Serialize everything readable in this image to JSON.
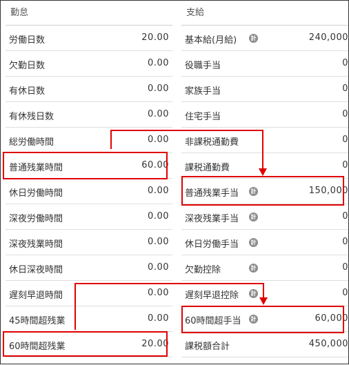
{
  "attendance": {
    "title": "勤怠",
    "rows": [
      {
        "label": "労働日数",
        "value": "20.00"
      },
      {
        "label": "欠勤日数",
        "value": "0.00"
      },
      {
        "label": "有休日数",
        "value": "0.00"
      },
      {
        "label": "有休残日数",
        "value": "0.00"
      },
      {
        "label": "総労働時間",
        "value": "0.00"
      },
      {
        "label": "普通残業時間",
        "value": "60.00"
      },
      {
        "label": "休日労働時間",
        "value": "0.00"
      },
      {
        "label": "深夜労働時間",
        "value": "0.00"
      },
      {
        "label": "深夜残業時間",
        "value": "0.00"
      },
      {
        "label": "休日深夜時間",
        "value": "0.00"
      },
      {
        "label": "遅刻早退時間",
        "value": "0.00"
      },
      {
        "label": "45時間超残業",
        "value": "0.00"
      },
      {
        "label": "60時間超残業",
        "value": "20.00"
      }
    ]
  },
  "payment": {
    "title": "支給",
    "calc_icon_glyph": "計",
    "rows": [
      {
        "label": "基本給(月給)",
        "value": "240,000",
        "calc_icon": true
      },
      {
        "label": "役職手当",
        "value": "0",
        "calc_icon": false
      },
      {
        "label": "家族手当",
        "value": "0",
        "calc_icon": false
      },
      {
        "label": "住宅手当",
        "value": "0",
        "calc_icon": false
      },
      {
        "label": "非課税通勤費",
        "value": "0",
        "calc_icon": false
      },
      {
        "label": "課税通勤費",
        "value": "0",
        "calc_icon": false
      },
      {
        "label": "普通残業手当",
        "value": "150,000",
        "calc_icon": true
      },
      {
        "label": "深夜残業手当",
        "value": "0",
        "calc_icon": true
      },
      {
        "label": "休日労働手当",
        "value": "0",
        "calc_icon": true
      },
      {
        "label": "欠勤控除",
        "value": "0",
        "calc_icon": true
      },
      {
        "label": "遅刻早退控除",
        "value": "0",
        "calc_icon": true
      },
      {
        "label": "60時間超手当",
        "value": "60,000",
        "calc_icon": true
      },
      {
        "label": "課税額合計",
        "value": "450,000",
        "calc_icon": false
      }
    ]
  },
  "highlight_color": "#e00000"
}
